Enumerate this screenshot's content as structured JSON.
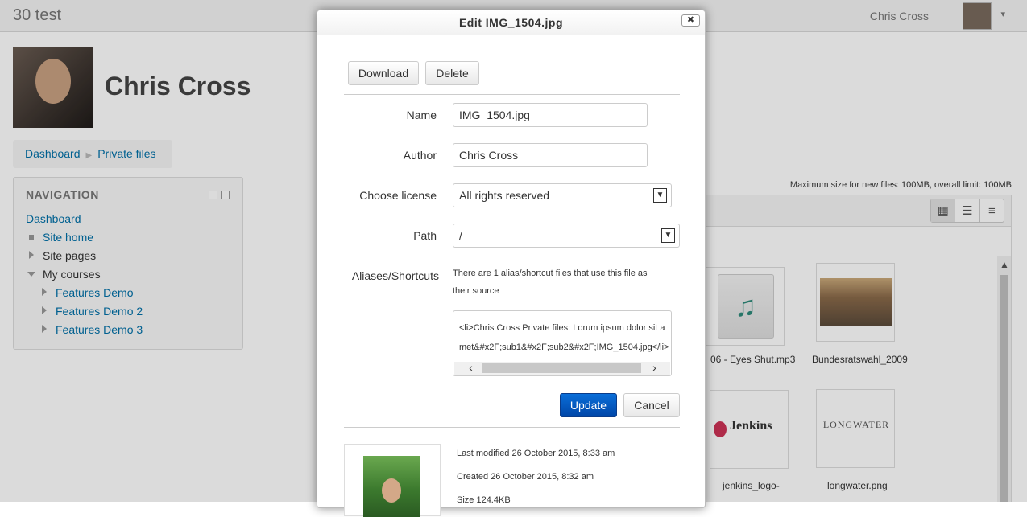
{
  "navbar": {
    "site_name": "30 test",
    "user_name": "Chris Cross",
    "caret": "▾"
  },
  "profile": {
    "name": "Chris Cross"
  },
  "breadcrumb": {
    "items": [
      "Dashboard",
      "Private files"
    ],
    "separator": "▶"
  },
  "navigation": {
    "title": "NAVIGATION",
    "items": [
      {
        "label": "Dashboard"
      },
      {
        "label": "Site home"
      },
      {
        "label": "Site pages"
      },
      {
        "label": "My courses"
      },
      {
        "label": "Features Demo"
      },
      {
        "label": "Features Demo 2"
      },
      {
        "label": "Features Demo 3"
      }
    ]
  },
  "filemanager": {
    "max_size_text": "Maximum size for new files: 100MB, overall limit: 100MB",
    "view_icons": [
      "▦",
      "☰",
      "≡"
    ],
    "scroll_up": "▲",
    "files": [
      {
        "label": "06 - Eyes Shut.mp3"
      },
      {
        "label": "Bundesratswahl_2009"
      },
      {
        "label": "jenkins_logo-"
      },
      {
        "label": "longwater.png"
      }
    ],
    "jenkins_text": "Jenkins",
    "longwater_text": "LONGWATER"
  },
  "dialog": {
    "title": "Edit IMG_1504.jpg",
    "close": "✖",
    "download_label": "Download",
    "delete_label": "Delete",
    "fields": {
      "name_label": "Name",
      "name_value": "IMG_1504.jpg",
      "author_label": "Author",
      "author_value": "Chris Cross",
      "license_label": "Choose license",
      "license_value": "All rights reserved",
      "path_label": "Path",
      "path_value": "/",
      "aliases_label": "Aliases/Shortcuts",
      "aliases_text": "There are 1 alias/shortcut files that use this file as their source",
      "aliases_content": "<li>Chris Cross Private files: Lorum ipsum dolor sit amet&#x2F;sub1&#x2F;sub2&#x2F;IMG_1504.jpg</li>"
    },
    "update_label": "Update",
    "cancel_label": "Cancel",
    "select_caret": "▼",
    "scroll_left": "‹",
    "scroll_right": "›",
    "meta": {
      "last_modified": "Last modified   26 October 2015, 8:33 am",
      "created": "Created   26 October 2015, 8:32 am",
      "size": "Size   124.4KB"
    }
  }
}
